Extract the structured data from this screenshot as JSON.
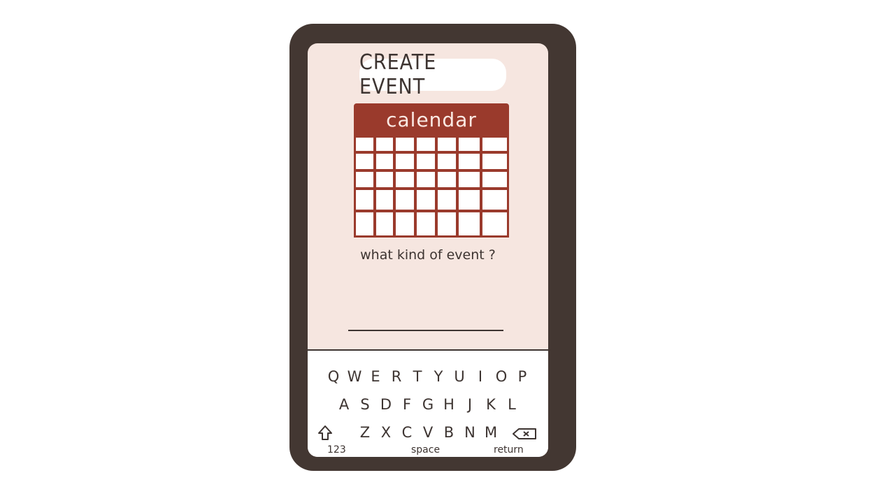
{
  "screen": {
    "title": "CREATE EVENT",
    "calendar_label": "calendar",
    "question": "what kind of event ?",
    "event_input": {
      "value": "",
      "placeholder": ""
    }
  },
  "keyboard": {
    "row1": [
      "Q",
      "W",
      "E",
      "R",
      "T",
      "Y",
      "U",
      "I",
      "O",
      "P"
    ],
    "row2": [
      "A",
      "S",
      "D",
      "F",
      "G",
      "H",
      "J",
      "K",
      "L"
    ],
    "row3": [
      "Z",
      "X",
      "C",
      "V",
      "B",
      "N",
      "M"
    ],
    "numbers_label": "123",
    "space_label": "space",
    "return_label": "return",
    "shift_icon": "shift-arrow-icon",
    "backspace_icon": "backspace-icon"
  },
  "colors": {
    "phone_frame": "#433732",
    "screen_bg": "#f6e6e0",
    "calendar_accent": "#9a3a2c",
    "ink": "#3d3431"
  }
}
